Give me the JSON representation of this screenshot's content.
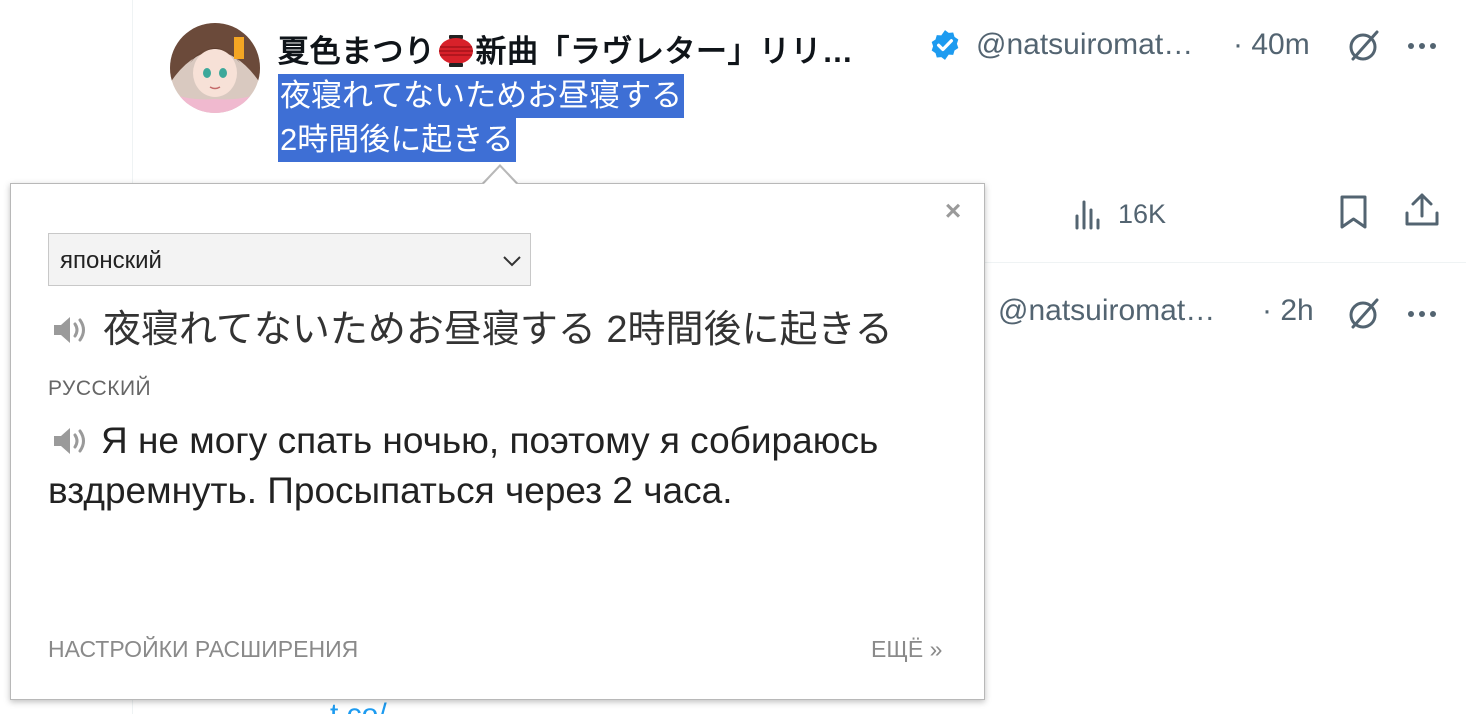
{
  "tweet1": {
    "author_name_part1": "夏色まつり",
    "author_name_part2": "新曲「ラヴレター」リリ…",
    "handle": "@natsuiromat…",
    "time": "· 40m",
    "text_line1": "夜寝れてないためお昼寝する",
    "text_line2": "2時間後に起きる",
    "views": "16K"
  },
  "tweet2": {
    "handle": "@natsuiromat…",
    "time": "· 2h",
    "link_partial": "t.co/..."
  },
  "popup": {
    "source_language": "японский",
    "source_text": "夜寝れてないためお昼寝する 2時間後に起きる",
    "target_language": "РУССКИЙ",
    "translated_text": "Я не могу спать ночью, поэтому я собираюсь вздремнуть. Просыпаться через 2 часа.",
    "close_label": "×",
    "settings_label": "НАСТРОЙКИ РАСШИРЕНИЯ",
    "more_label": "ЕЩЁ »"
  },
  "colors": {
    "selection": "#3e6fd5",
    "secondary_text": "#536471",
    "verified": "#1d9bf0",
    "lantern": "#d8212a"
  },
  "icons": [
    "verified-badge-icon",
    "grok-icon",
    "more-icon",
    "views-chart-icon",
    "bookmark-icon",
    "share-icon",
    "speaker-icon",
    "chevron-down-icon",
    "close-icon",
    "lantern-emoji-icon"
  ]
}
